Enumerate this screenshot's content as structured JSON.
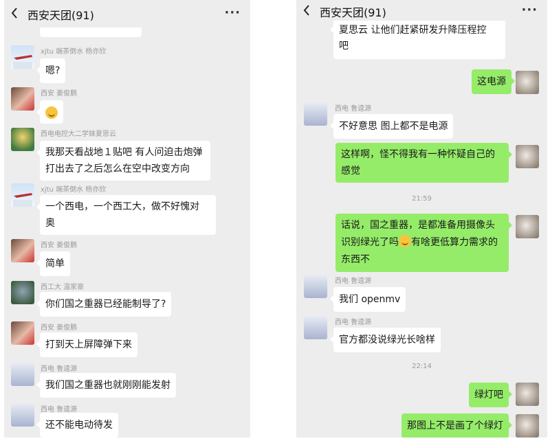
{
  "left": {
    "header": {
      "title": "西安天团(91)",
      "more": "···"
    },
    "messages": [
      {
        "sender": "xjtu 端茶倒水 杨亦欣",
        "text": "嗯?"
      },
      {
        "sender": "西安 姜俊鹏",
        "emoji": "smile-emoji"
      },
      {
        "sender": "西电电控大二学妹夏思云",
        "line1": "我那天看战地１贴吧 有人问迫击炮弹",
        "line2": "打出去了之后怎么在空中改变方向"
      },
      {
        "sender": "xjtu 端茶倒水 杨亦欣",
        "line1": "一个西电，一个西工大，做不好愧对",
        "line2": "奥"
      },
      {
        "sender": "西安 姜俊鹏",
        "text": "简单"
      },
      {
        "sender": "西工大 温家豪",
        "text": "你们国之重器已经能制导了?"
      },
      {
        "sender": "西安 姜俊鹏",
        "text": "打到天上屏障弹下来"
      },
      {
        "sender": "西电 鲁逵源",
        "text": "我们国之重器也就刚刚能发射"
      },
      {
        "sender": "西电 鲁逵源",
        "text": "还不能电动待发"
      }
    ]
  },
  "right": {
    "header": {
      "title": "西安天团(91)",
      "more": "···"
    },
    "messages": [
      {
        "line1": "夏思云  让他们赶紧研发升降压程控",
        "line2": "吧"
      },
      {
        "text": "这电源"
      },
      {
        "sender": "西电 鲁逵源",
        "text": "不好意思 图上都不是电源"
      },
      {
        "line1": "这样啊，怪不得我有一种怀疑自己的",
        "line2": "感觉"
      },
      {
        "time": "21:59"
      },
      {
        "line1": "话说，国之重器，是都准备用摄像头",
        "line2a": "识别绿光了吗",
        "line2b": "有啥更低算力需求的",
        "line3": "东西不"
      },
      {
        "sender": "西电 鲁逵源",
        "text": "我们 openmv"
      },
      {
        "sender": "西电 鲁逵源",
        "text": "官方都没说绿光长啥样"
      },
      {
        "time": "22:14"
      },
      {
        "text": "绿灯吧"
      },
      {
        "text": "那图上不是画了个绿灯"
      }
    ]
  }
}
